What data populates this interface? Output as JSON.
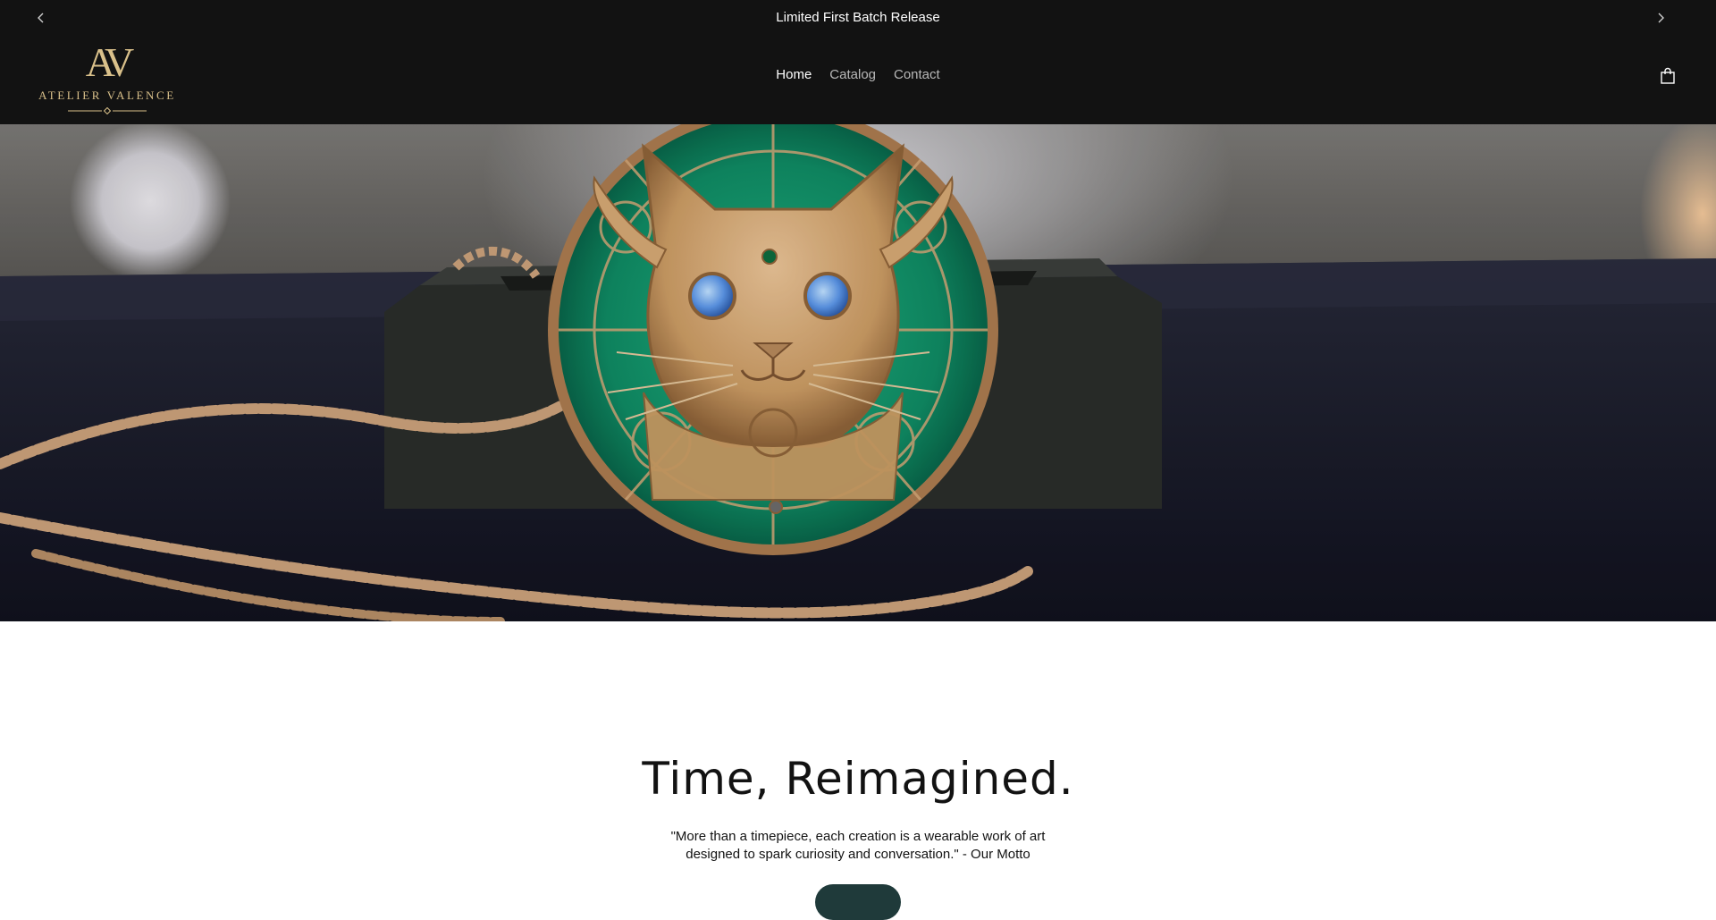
{
  "announcement": {
    "text": "Limited First Batch Release",
    "prev_icon": "chevron-left-icon",
    "next_icon": "chevron-right-icon"
  },
  "header": {
    "logo_monogram": "AV",
    "logo_wordmark": "ATELIER VALENCE",
    "nav": [
      {
        "label": "Home",
        "active": true
      },
      {
        "label": "Catalog",
        "active": false
      },
      {
        "label": "Contact",
        "active": false
      }
    ],
    "cart_icon": "shopping-bag-icon"
  },
  "hero": {
    "image_subject": "cat-face pocket watch pendant with green enamel and gold chain",
    "colors": {
      "enamel": "#0f8a63",
      "gold": "#c99a63",
      "eyes": "#5b95e6"
    }
  },
  "intro": {
    "title": "Time, Reimagined.",
    "quote": "\"More than a timepiece, each creation is a wearable work of art designed to spark curiosity and conversation.\" - Our Motto"
  },
  "colors": {
    "header_bg": "#121212",
    "logo_gold": "#d9c08a",
    "page_bg": "#ffffff",
    "cta_bg": "#1f3a3a"
  }
}
